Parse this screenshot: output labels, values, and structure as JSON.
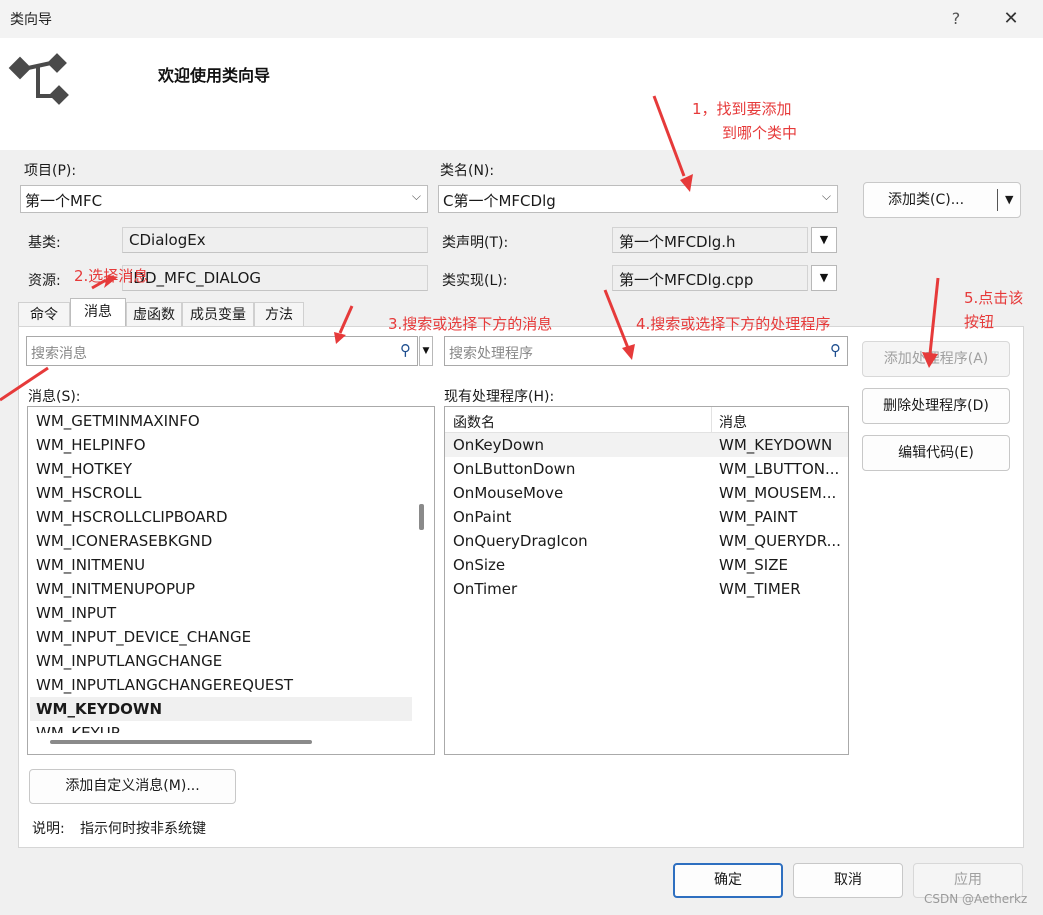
{
  "window": {
    "title": "类向导",
    "help_label": "?",
    "close_label": "✕"
  },
  "header": {
    "welcome": "欢迎使用类向导",
    "icon": "class-hierarchy-icon"
  },
  "project": {
    "label": "项目(P):",
    "value": "第一个MFC"
  },
  "classname": {
    "label": "类名(N):",
    "value": "C第一个MFCDlg"
  },
  "add_class_button": "添加类(C)...",
  "base_class": {
    "label": "基类:",
    "value": "CDialogEx"
  },
  "resource": {
    "label": "资源:",
    "value": "IDD_MFC_DIALOG"
  },
  "class_decl": {
    "label": "类声明(T):",
    "value": "第一个MFCDlg.h"
  },
  "class_impl": {
    "label": "类实现(L):",
    "value": "第一个MFCDlg.cpp"
  },
  "tabs": [
    "命令",
    "消息",
    "虚函数",
    "成员变量",
    "方法"
  ],
  "active_tab": "消息",
  "search_messages": {
    "placeholder": "搜索消息"
  },
  "search_handlers": {
    "placeholder": "搜索处理程序"
  },
  "messages": {
    "label": "消息(S):",
    "items": [
      "WM_GETMINMAXINFO",
      "WM_HELPINFO",
      "WM_HOTKEY",
      "WM_HSCROLL",
      "WM_HSCROLLCLIPBOARD",
      "WM_ICONERASEBKGND",
      "WM_INITMENU",
      "WM_INITMENUPOPUP",
      "WM_INPUT",
      "WM_INPUT_DEVICE_CHANGE",
      "WM_INPUTLANGCHANGE",
      "WM_INPUTLANGCHANGEREQUEST",
      "WM_KEYDOWN",
      "WM_KEYUP"
    ],
    "selected": "WM_KEYDOWN"
  },
  "handlers": {
    "label": "现有处理程序(H):",
    "columns": [
      "函数名",
      "消息"
    ],
    "rows": [
      [
        "OnKeyDown",
        "WM_KEYDOWN"
      ],
      [
        "OnLButtonDown",
        "WM_LBUTTON..."
      ],
      [
        "OnMouseMove",
        "WM_MOUSEM..."
      ],
      [
        "OnPaint",
        "WM_PAINT"
      ],
      [
        "OnQueryDragIcon",
        "WM_QUERYDR..."
      ],
      [
        "OnSize",
        "WM_SIZE"
      ],
      [
        "OnTimer",
        "WM_TIMER"
      ]
    ]
  },
  "buttons": {
    "add_handler": "添加处理程序(A)",
    "delete_handler": "删除处理程序(D)",
    "edit_code": "编辑代码(E)",
    "add_custom_message": "添加自定义消息(M)...",
    "ok": "确定",
    "cancel": "取消",
    "apply": "应用"
  },
  "description": {
    "label": "说明:",
    "text": "指示何时按非系统键"
  },
  "annotations": {
    "a1_line1": "1，找到要添加",
    "a1_line2": "到哪个类中",
    "a2": "2.选择消息",
    "a3": "3.搜索或选择下方的消息",
    "a4": "4.搜索或选择下方的处理程序",
    "a5_line1": "5.点击该",
    "a5_line2": "按钮",
    "color": "#e63a3a"
  },
  "watermark": "CSDN @Aetherkz"
}
